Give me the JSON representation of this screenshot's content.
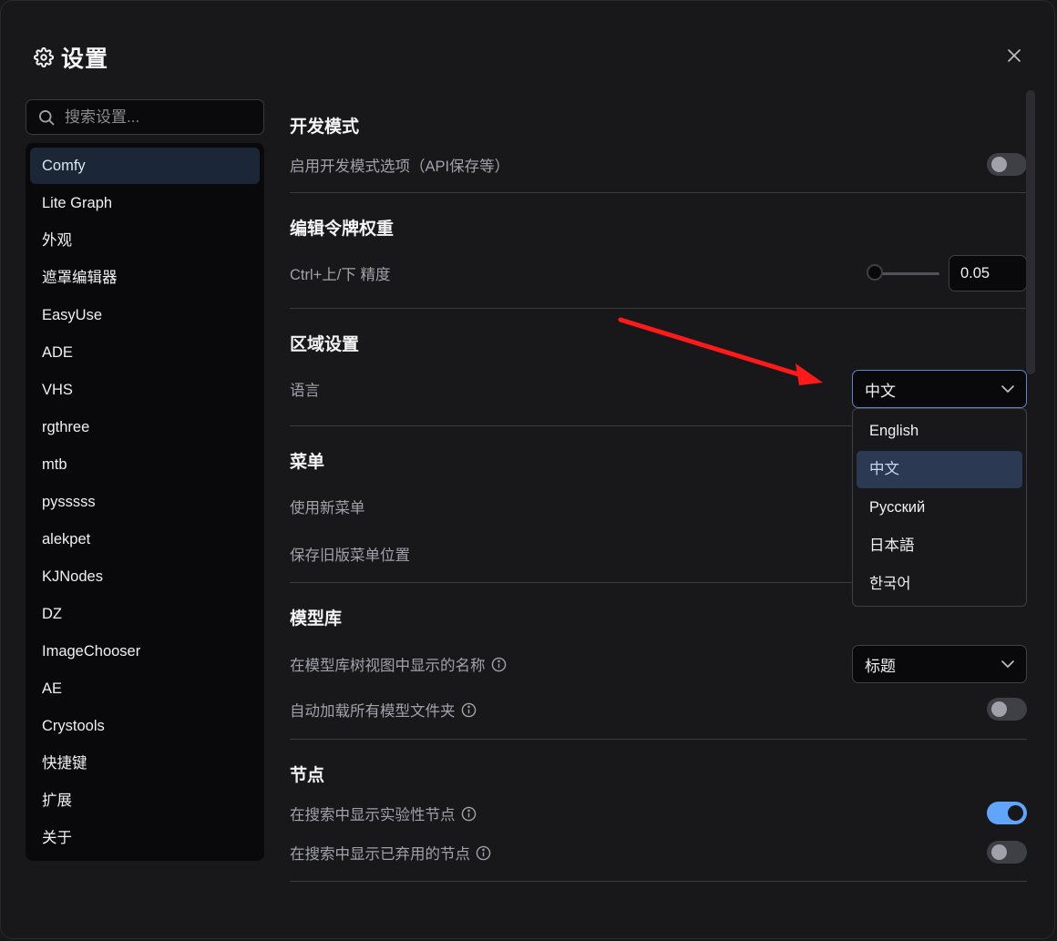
{
  "dialog": {
    "title": "设置",
    "title_icon": "gear-icon",
    "close_icon": "close-icon"
  },
  "search": {
    "placeholder": "搜索设置...",
    "value": "",
    "icon": "search-icon"
  },
  "sidebar": {
    "active_index": 0,
    "items": [
      {
        "label": "Comfy"
      },
      {
        "label": "Lite Graph"
      },
      {
        "label": "外观"
      },
      {
        "label": "遮罩编辑器"
      },
      {
        "label": "EasyUse"
      },
      {
        "label": "ADE"
      },
      {
        "label": "VHS"
      },
      {
        "label": "rgthree"
      },
      {
        "label": "mtb"
      },
      {
        "label": "pysssss"
      },
      {
        "label": "alekpet"
      },
      {
        "label": "KJNodes"
      },
      {
        "label": "DZ"
      },
      {
        "label": "ImageChooser"
      },
      {
        "label": "AE"
      },
      {
        "label": "Crystools"
      },
      {
        "label": "快捷键"
      },
      {
        "label": "扩展"
      },
      {
        "label": "关于"
      }
    ]
  },
  "sections": {
    "dev_mode": {
      "heading": "开发模式",
      "enable_dev": {
        "label": "启用开发模式选项（API保存等）",
        "enabled": false
      }
    },
    "token_weight": {
      "heading": "编辑令牌权重",
      "precision": {
        "label": "Ctrl+上/下 精度",
        "value": "0.05",
        "slider_fraction": 0.0
      }
    },
    "locale": {
      "heading": "区域设置",
      "language": {
        "label": "语言",
        "value": "中文",
        "options": [
          "English",
          "中文",
          "Русский",
          "日本語",
          "한국어"
        ],
        "selected_index": 1
      }
    },
    "menu": {
      "heading": "菜单",
      "use_new_menu": {
        "label": "使用新菜单"
      },
      "save_legacy_position": {
        "label": "保存旧版菜单位置"
      }
    },
    "model_library": {
      "heading": "模型库",
      "tree_name": {
        "label": "在模型库树视图中显示的名称",
        "value": "标题"
      },
      "autoload_folders": {
        "label": "自动加载所有模型文件夹",
        "enabled": false
      }
    },
    "nodes": {
      "heading": "节点",
      "show_experimental": {
        "label": "在搜索中显示实验性节点",
        "enabled": true
      },
      "show_deprecated": {
        "label": "在搜索中显示已弃用的节点",
        "enabled": false
      }
    }
  },
  "colors": {
    "background": "#18181b",
    "accent": "#60a5fa",
    "annotation_arrow": "#ff1a1a",
    "active_nav": "#1b2636"
  }
}
